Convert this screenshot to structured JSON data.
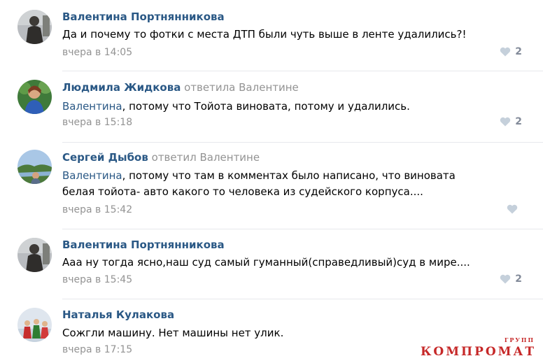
{
  "comments": [
    {
      "author": "Валентина Портнянникова",
      "reply_to": "",
      "text_lines": [
        "Да и почему то фотки с места ДТП были чуть выше в ленте удалились?!"
      ],
      "time": "вчера в 14:05",
      "likes": "2"
    },
    {
      "author": "Людмила Жидкова",
      "reply_to": "ответила Валентине",
      "text_address": "Валентина",
      "text_lines": [
        ", потому что Тойота виновата, потому и удалились."
      ],
      "time": "вчера в 15:18",
      "likes": "2"
    },
    {
      "author": "Сергей Дыбов",
      "reply_to": "ответил Валентине",
      "text_address": "Валентина",
      "text_lines": [
        ", потому что там в комментах было написано, что виновата",
        "белая тойота- авто какого то человека из судейского корпуса...."
      ],
      "time": "вчера в 15:42",
      "likes": ""
    },
    {
      "author": "Валентина Портнянникова",
      "reply_to": "",
      "text_lines": [
        "Ааа ну тогда ясно,наш суд самый гуманный(справедливый)суд в мире...."
      ],
      "time": "вчера в 15:45",
      "likes": "2"
    },
    {
      "author": "Наталья Кулакова",
      "reply_to": "",
      "text_lines": [
        "Сожгли машину. Нет машины нет улик."
      ],
      "time": "вчера в 17:15",
      "likes": ""
    }
  ],
  "watermark": {
    "main": "КОМПРОМАТ",
    "sup": "ГРУПП"
  },
  "colors": {
    "author": "#2a5885",
    "meta": "#939393",
    "divider": "#e7e8ec",
    "like": "#c5d0db",
    "watermark": "#c62828"
  },
  "icons": [
    "heart-icon"
  ]
}
